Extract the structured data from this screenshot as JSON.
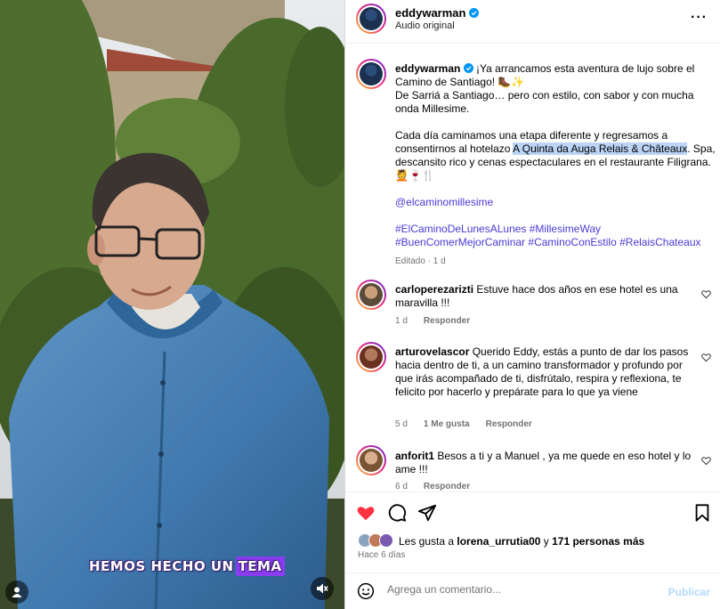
{
  "video": {
    "caption_text": "HEMOS HECHO UN",
    "caption_highlight": "TEMA",
    "profile_icon": "person-icon",
    "mute_icon": "muted-speaker-icon"
  },
  "header": {
    "username": "eddywarman",
    "subtitle": "Audio original",
    "more_icon": "ellipsis-icon"
  },
  "post": {
    "username": "eddywarman",
    "line1": "¡Ya arrancamos esta aventura de lujo sobre el Camino de Santiago! 🥾✨",
    "line2": "De Sarriá a Santiago… pero con estilo, con sabor y con mucha onda Millesime.",
    "para2_start": "Cada día caminamos una etapa diferente y regresamos a consentirnos al hotelazo ",
    "para2_highlight": "A Quinta da Auga Relais & Châteaux",
    "para2_end": ". Spa, descansito rico y cenas espectaculares en el restaurante Filigrana. 💆🍷🍴",
    "mention": "@elcaminomillesime",
    "hashtags_1": "#ElCaminoDeLunesALunes #MillesimeWay",
    "hashtags_2": "#BuenComerMejorCaminar #CaminoConEstilo #RelaisChateaux",
    "edited": "Editado · 1 d"
  },
  "comments": [
    {
      "user": "carloperezarizti",
      "text": "Estuve hace dos años en ese hotel es una maravilla !!!",
      "time": "1 d",
      "likes": "",
      "reply": "Responder"
    },
    {
      "user": "arturovelascor",
      "text": "Querido Eddy, estás a punto de dar los pasos hacia dentro de ti, a un camino transformador y profundo por que irás acompañado de ti, disfrútalo, respira y reflexiona, te felicito por hacerlo y prepárate para lo que ya viene",
      "time": "5 d",
      "likes": "1 Me gusta",
      "reply": "Responder"
    },
    {
      "user": "anforit1",
      "text": "Besos a ti y a Manuel , ya me quede en eso hotel y lo ame !!!",
      "time": "6 d",
      "likes": "",
      "reply": "Responder"
    }
  ],
  "actions": {
    "like_icon": "heart-filled-icon",
    "comment_icon": "comment-bubble-icon",
    "share_icon": "paper-plane-icon",
    "save_icon": "bookmark-icon",
    "like_color": "#ff3040"
  },
  "likes": {
    "prefix": "Les gusta a",
    "user": "lorena_urrutia00",
    "middle": "y",
    "others": "171 personas más"
  },
  "timestamp": "Hace 6 días",
  "add_comment": {
    "placeholder": "Agrega un comentario...",
    "emoji_icon": "smiley-icon",
    "publish_label": "Publicar"
  },
  "colors": {
    "verified": "#0095f6",
    "link": "#4b39d6",
    "selection": "#bcd4f6",
    "caption_highlight": "#8a3cf0"
  }
}
